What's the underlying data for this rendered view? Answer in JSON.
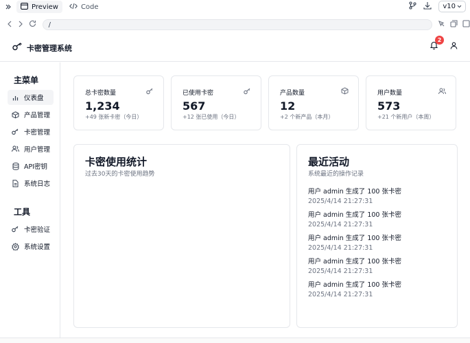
{
  "toolbar": {
    "preview_label": "Preview",
    "code_label": "Code",
    "version": "v10"
  },
  "browser": {
    "url": "/"
  },
  "header": {
    "title": "卡密管理系统",
    "notification_count": "2"
  },
  "sidebar": {
    "main_heading": "主菜单",
    "main_items": [
      {
        "label": "仪表盘",
        "icon": "bar-chart-icon"
      },
      {
        "label": "产品管理",
        "icon": "package-icon"
      },
      {
        "label": "卡密管理",
        "icon": "key-icon"
      },
      {
        "label": "用户管理",
        "icon": "users-icon"
      },
      {
        "label": "API密钥",
        "icon": "database-icon"
      },
      {
        "label": "系统日志",
        "icon": "file-text-icon"
      }
    ],
    "tools_heading": "工具",
    "tools_items": [
      {
        "label": "卡密验证",
        "icon": "key-icon"
      },
      {
        "label": "系统设置",
        "icon": "gear-icon"
      }
    ]
  },
  "stats": [
    {
      "label": "总卡密数量",
      "value": "1,234",
      "sub": "+49 张新卡密（今日）",
      "icon": "key-icon"
    },
    {
      "label": "已使用卡密",
      "value": "567",
      "sub": "+12 张已使用（今日）",
      "icon": "key-icon"
    },
    {
      "label": "产品数量",
      "value": "12",
      "sub": "+2 个新产品（本月）",
      "icon": "package-icon"
    },
    {
      "label": "用户数量",
      "value": "573",
      "sub": "+21 个新用户（本周）",
      "icon": "users-icon"
    }
  ],
  "usage": {
    "title": "卡密使用统计",
    "description": "过去30天的卡密使用趋势"
  },
  "activity": {
    "title": "最近活动",
    "description": "系统最近的操作记录",
    "items": [
      {
        "text": "用户 admin 生成了 100 张卡密",
        "time": "2025/4/14 21:27:31"
      },
      {
        "text": "用户 admin 生成了 100 张卡密",
        "time": "2025/4/14 21:27:31"
      },
      {
        "text": "用户 admin 生成了 100 张卡密",
        "time": "2025/4/14 21:27:31"
      },
      {
        "text": "用户 admin 生成了 100 张卡密",
        "time": "2025/4/14 21:27:31"
      },
      {
        "text": "用户 admin 生成了 100 张卡密",
        "time": "2025/4/14 21:27:31"
      }
    ]
  },
  "colors": {
    "accent": "#111827",
    "badge": "#ef4444",
    "muted": "#6b7280",
    "border": "#e5e7eb"
  }
}
